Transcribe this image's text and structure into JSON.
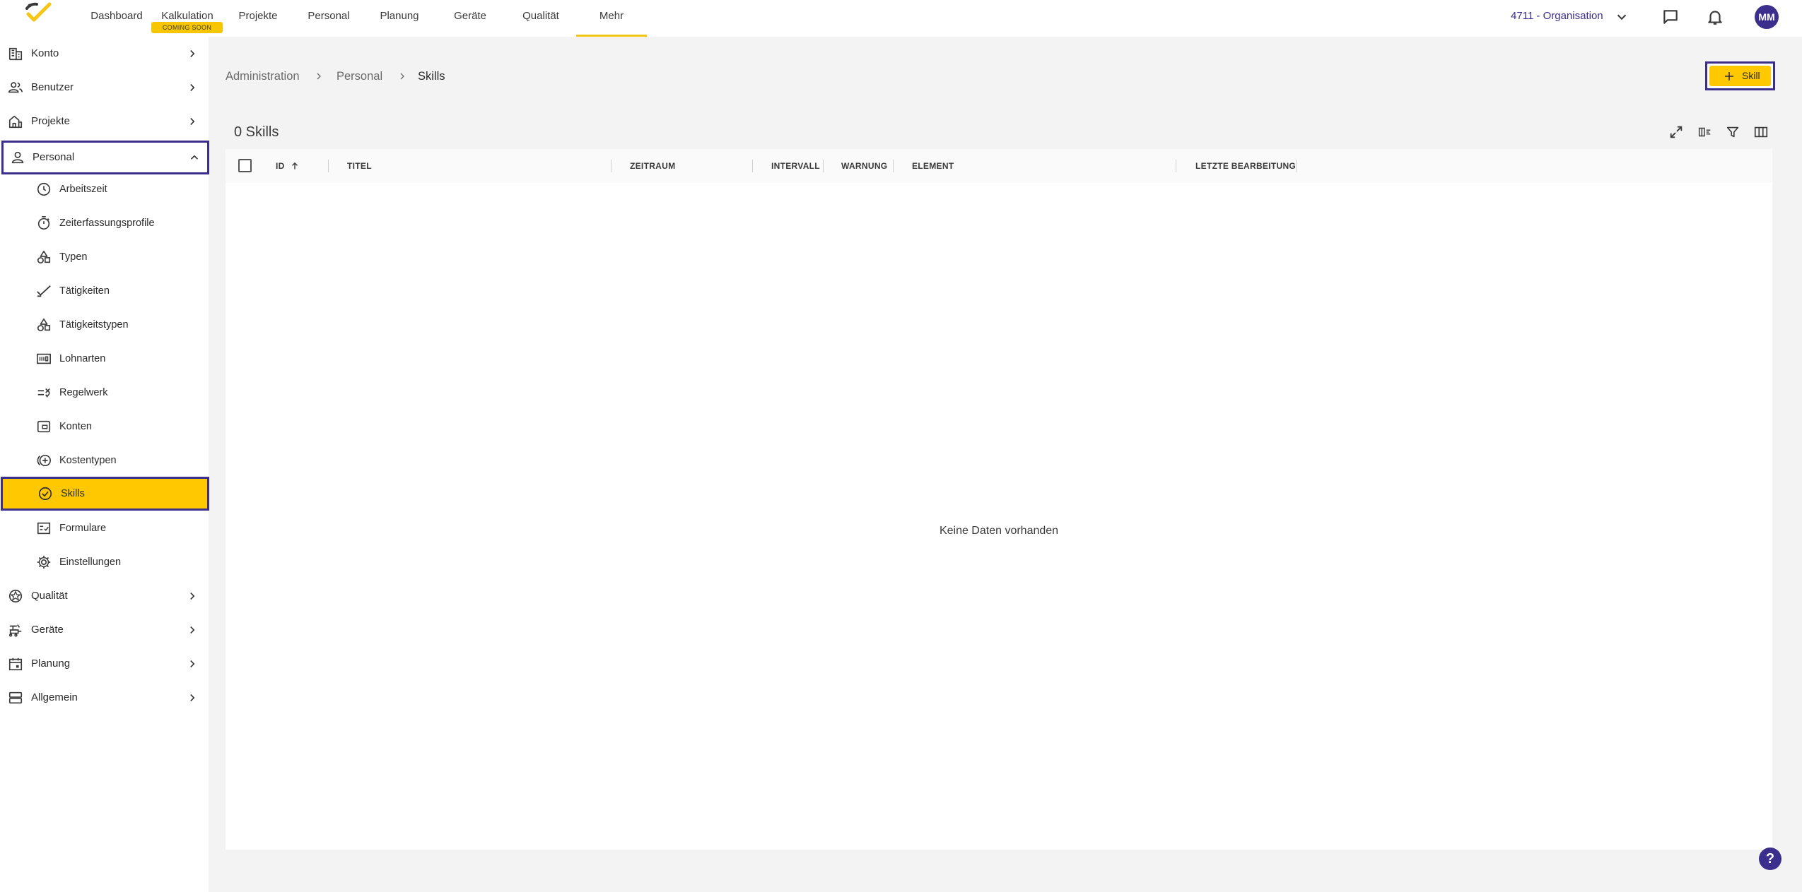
{
  "topnav": {
    "items": [
      {
        "label": "Dashboard"
      },
      {
        "label": "Kalkulation"
      },
      {
        "label": "Projekte"
      },
      {
        "label": "Personal"
      },
      {
        "label": "Planung"
      },
      {
        "label": "Geräte"
      },
      {
        "label": "Qualität"
      },
      {
        "label": "Mehr"
      }
    ],
    "active": "Mehr",
    "coming_soon_badge": "COMING SOON",
    "organization": "4711 - Organisation",
    "avatar_initials": "MM"
  },
  "sidebar": {
    "items": [
      {
        "label": "Konto",
        "icon": "building-icon"
      },
      {
        "label": "Benutzer",
        "icon": "users-icon"
      },
      {
        "label": "Projekte",
        "icon": "project-icon"
      },
      {
        "label": "Personal",
        "icon": "person-icon"
      },
      {
        "label": "Arbeitszeit",
        "icon": "clock-icon"
      },
      {
        "label": "Zeiterfassungsprofile",
        "icon": "stopwatch-icon"
      },
      {
        "label": "Typen",
        "icon": "shapes-icon"
      },
      {
        "label": "Tätigkeiten",
        "icon": "check-icon"
      },
      {
        "label": "Tätigkeitstypen",
        "icon": "shapes-icon"
      },
      {
        "label": "Lohnarten",
        "icon": "payment-icon"
      },
      {
        "label": "Regelwerk",
        "icon": "rules-icon"
      },
      {
        "label": "Konten",
        "icon": "account-icon"
      },
      {
        "label": "Kostentypen",
        "icon": "cost-icon"
      },
      {
        "label": "Skills",
        "icon": "check-circle-icon"
      },
      {
        "label": "Formulare",
        "icon": "form-icon"
      },
      {
        "label": "Einstellungen",
        "icon": "gear-icon"
      },
      {
        "label": "Qualität",
        "icon": "quality-icon"
      },
      {
        "label": "Geräte",
        "icon": "device-icon"
      },
      {
        "label": "Planung",
        "icon": "calendar-icon"
      },
      {
        "label": "Allgemein",
        "icon": "general-icon"
      }
    ],
    "expanded": "Personal",
    "selected": "Skills"
  },
  "breadcrumb": [
    "Administration",
    "Personal",
    "Skills"
  ],
  "add_button_label": "Skill",
  "table": {
    "title": "0 Skills",
    "columns": [
      "ID",
      "TITEL",
      "ZEITRAUM",
      "INTERVALL",
      "WARNUNG",
      "ELEMENT",
      "LETZTE BEARBEITUNG"
    ],
    "sort": {
      "column": "ID",
      "direction": "ascending"
    },
    "empty_message": "Keine Daten vorhanden",
    "rows": []
  },
  "help_label": "?",
  "colors": {
    "accent": "#ffc800",
    "brand": "#3c2e8c",
    "background": "#f3f3f3"
  }
}
